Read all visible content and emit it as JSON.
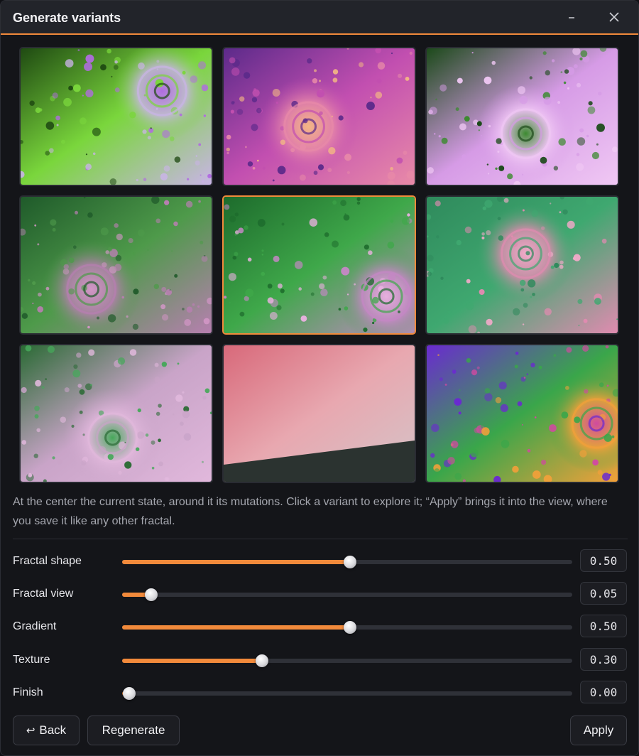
{
  "window": {
    "title": "Generate variants",
    "minimize_icon": "minimize-icon",
    "close_icon": "close-icon"
  },
  "variants": [
    {
      "label": "variant-1",
      "palette": [
        "#1f4a12",
        "#7ad63c",
        "#c9b4e6",
        "#b06ce0"
      ]
    },
    {
      "label": "variant-2",
      "palette": [
        "#5c2a8a",
        "#c24fb0",
        "#e88aa8",
        "#f4b884"
      ]
    },
    {
      "label": "variant-3",
      "palette": [
        "#1c4a1a",
        "#d69be6",
        "#f0c8f4",
        "#3c8a30"
      ]
    },
    {
      "label": "variant-4",
      "palette": [
        "#1f5a2a",
        "#4e9a4a",
        "#b77fb0",
        "#d296c6"
      ]
    },
    {
      "label": "variant-5 (current)",
      "palette": [
        "#1d6b2c",
        "#3fa84a",
        "#c488c4",
        "#e7b0de"
      ]
    },
    {
      "label": "variant-6",
      "palette": [
        "#2f8a5c",
        "#3fa870",
        "#e08bb0",
        "#f0aac8"
      ]
    },
    {
      "label": "variant-7",
      "palette": [
        "#2a6a34",
        "#c9a4c8",
        "#e1b8dc",
        "#46a85a"
      ]
    },
    {
      "label": "variant-8",
      "palette": [
        "#d8697a",
        "#e8a8b0",
        "#d4c4c8",
        "#2b3330"
      ]
    },
    {
      "label": "variant-9",
      "palette": [
        "#6a2ad0",
        "#3aa64a",
        "#f2a03a",
        "#d04aa0"
      ]
    }
  ],
  "description": "At the center the current state, around it its mutations. Click a variant to explore it; “Apply” brings it into the view, where you save it like any other fractal.",
  "sliders": [
    {
      "label": "Fractal shape",
      "value": 0.5,
      "display": "0.50"
    },
    {
      "label": "Fractal view",
      "value": 0.05,
      "display": "0.05"
    },
    {
      "label": "Gradient",
      "value": 0.5,
      "display": "0.50"
    },
    {
      "label": "Texture",
      "value": 0.3,
      "display": "0.30"
    },
    {
      "label": "Finish",
      "value": 0.0,
      "display": "0.00"
    }
  ],
  "buttons": {
    "back_label": "Back",
    "back_icon": "return-arrow-icon",
    "regenerate_label": "Regenerate",
    "apply_label": "Apply"
  },
  "colors": {
    "accent": "#f28a3b",
    "background": "#141519",
    "titlebar": "#22242a"
  }
}
